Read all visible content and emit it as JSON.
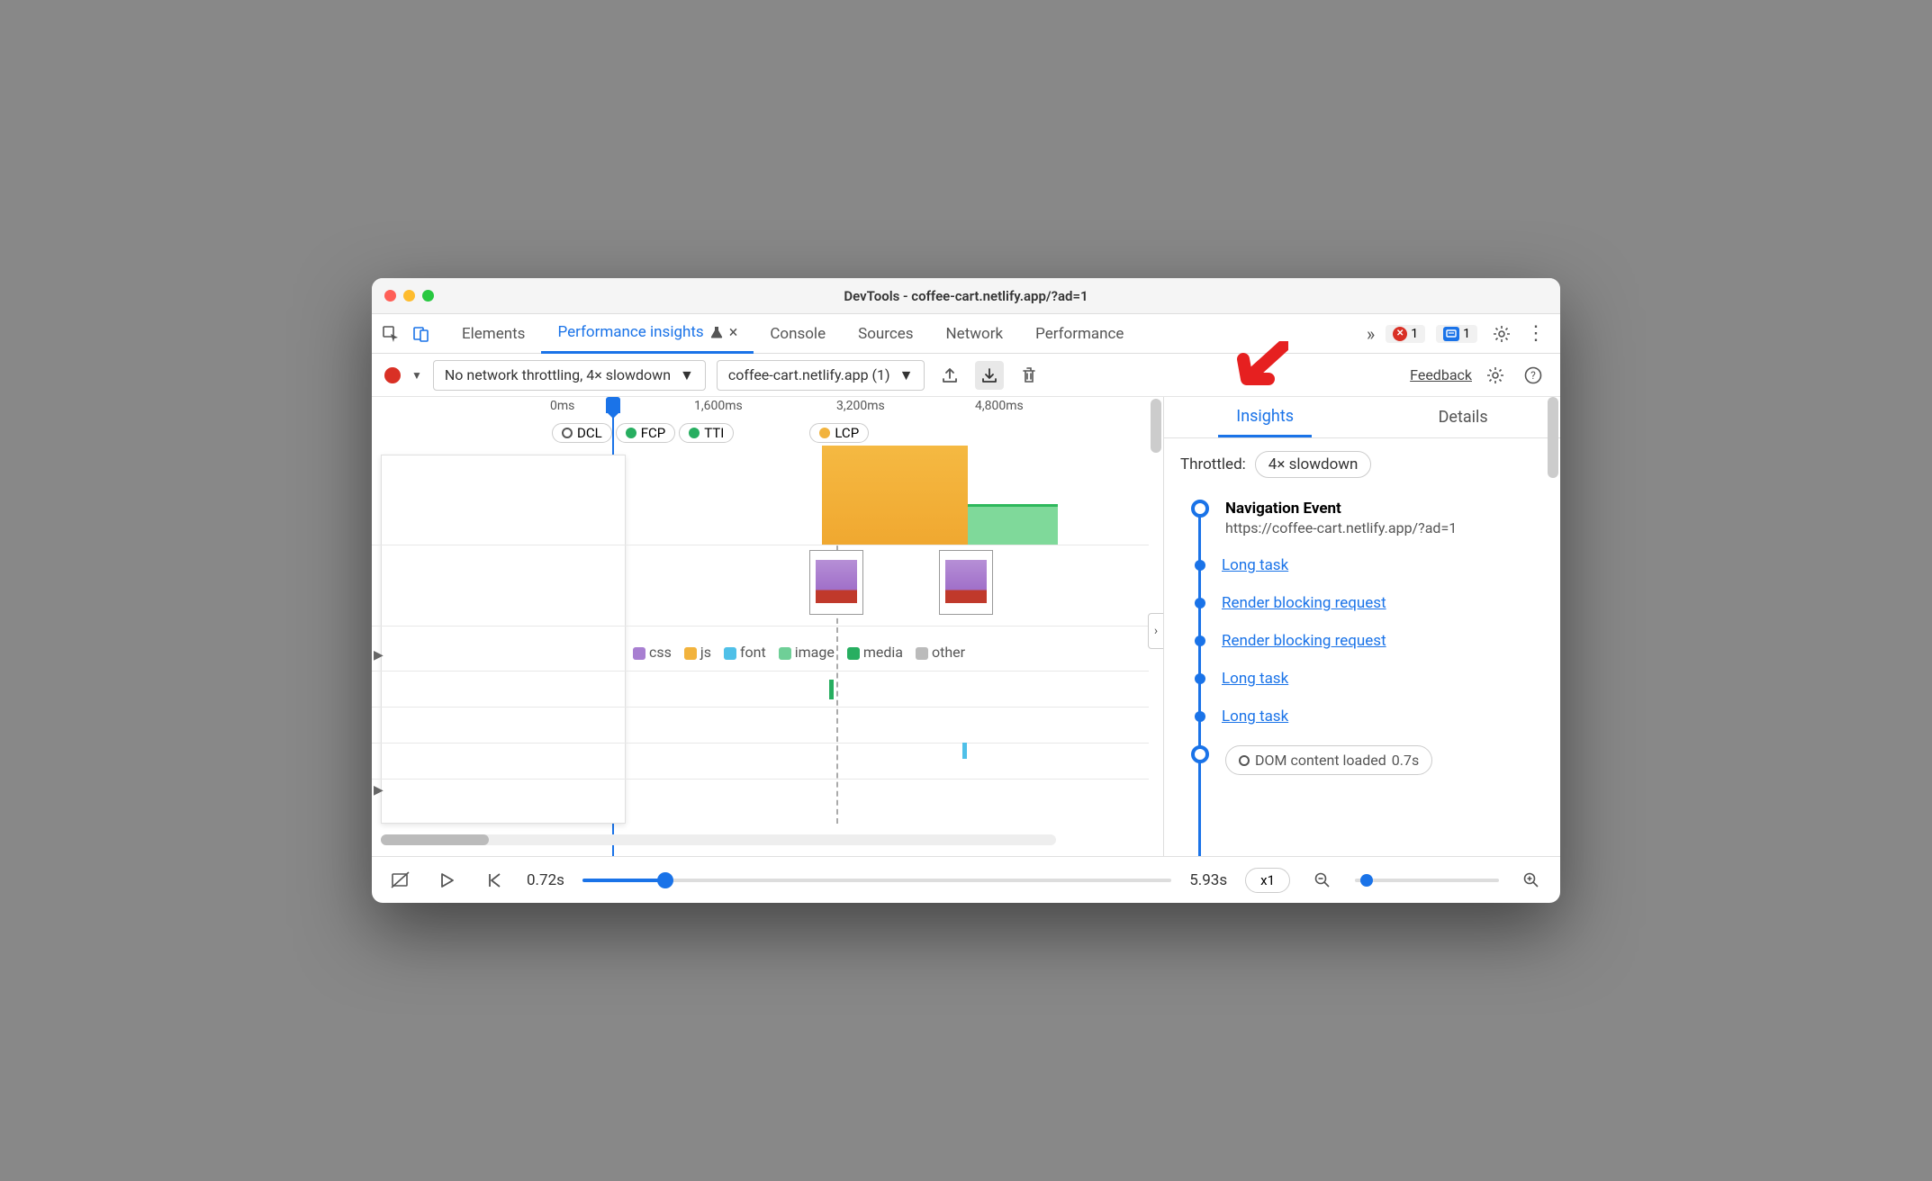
{
  "window": {
    "title": "DevTools - coffee-cart.netlify.app/?ad=1"
  },
  "tabs": {
    "items": [
      "Elements",
      "Performance insights",
      "Console",
      "Sources",
      "Network",
      "Performance"
    ],
    "active_index": 1,
    "overflow": "»",
    "errors_count": "1",
    "messages_count": "1"
  },
  "subtoolbar": {
    "throttle_select": "No network throttling, 4× slowdown",
    "recording_select": "coffee-cart.netlify.app (1)",
    "feedback": "Feedback"
  },
  "timeline": {
    "ruler": [
      "0ms",
      "1,600ms",
      "3,200ms",
      "4,800ms"
    ],
    "markers": [
      "DCL",
      "FCP",
      "TTI",
      "LCP"
    ],
    "legend": [
      {
        "label": "css",
        "color": "#a87fd1"
      },
      {
        "label": "js",
        "color": "#f2b33d"
      },
      {
        "label": "font",
        "color": "#4fc0e8"
      },
      {
        "label": "image",
        "color": "#6fcf97"
      },
      {
        "label": "media",
        "color": "#27ae60"
      },
      {
        "label": "other",
        "color": "#bbb"
      }
    ]
  },
  "sidebar": {
    "tabs": [
      "Insights",
      "Details"
    ],
    "active_index": 0,
    "throttled_label": "Throttled:",
    "throttled_value": "4× slowdown",
    "insights": {
      "nav_title": "Navigation Event",
      "nav_url": "https://coffee-cart.netlify.app/?ad=1",
      "items": [
        "Long task",
        "Render blocking request",
        "Render blocking request",
        "Long task",
        "Long task"
      ],
      "dcl_label": "DOM content loaded",
      "dcl_time": "0.7s"
    }
  },
  "footer": {
    "start_time": "0.72s",
    "end_time": "5.93s",
    "speed": "x1"
  }
}
